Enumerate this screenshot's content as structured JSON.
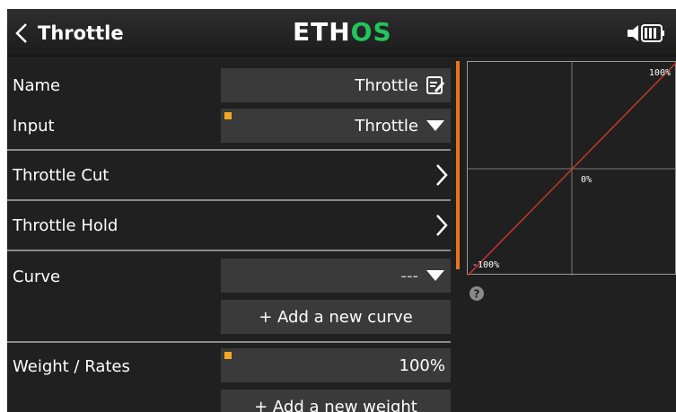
{
  "header": {
    "title": "Throttle",
    "logo_main": "ETH",
    "logo_accent": "OS"
  },
  "rows": {
    "name": {
      "label": "Name",
      "value": "Throttle"
    },
    "input": {
      "label": "Input",
      "value": "Throttle"
    },
    "throttle_cut": {
      "label": "Throttle Cut"
    },
    "throttle_hold": {
      "label": "Throttle Hold"
    },
    "curve": {
      "label": "Curve",
      "value": "---",
      "add_button": "+ Add a new curve"
    },
    "weight": {
      "label": "Weight / Rates",
      "value": "100%",
      "add_button": "+ Add a new weight"
    }
  },
  "curve_graph": {
    "label_top_right": "100%",
    "label_center": "0%",
    "label_bottom_left": "-100%",
    "line_color": "#c0392b"
  },
  "colors": {
    "accent": "#e8731c",
    "marker": "#f5a623",
    "logo_accent": "#22c55e"
  }
}
